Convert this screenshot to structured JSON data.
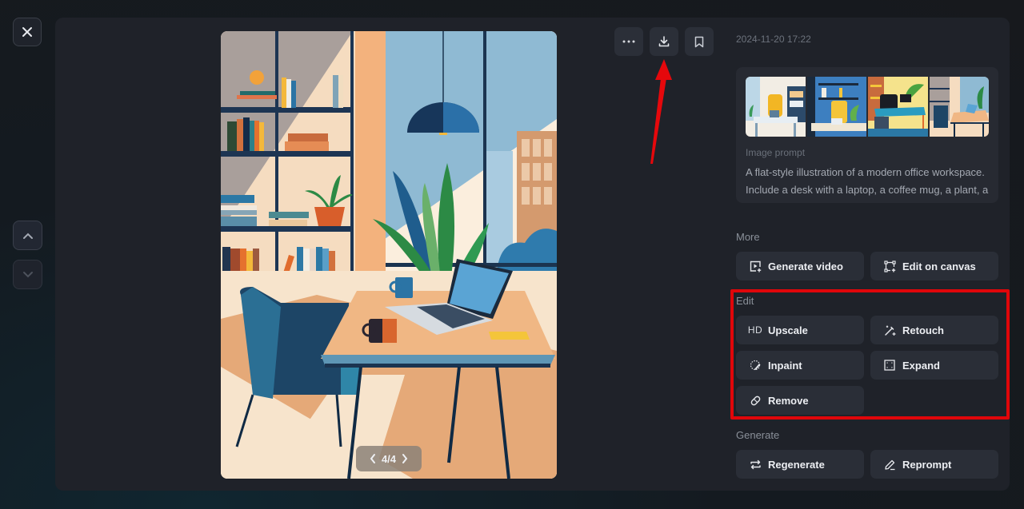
{
  "nav": {
    "close_icon": "close-icon",
    "prev_icon": "chevron-up-icon",
    "next_icon": "chevron-down-icon"
  },
  "viewer": {
    "image_description": "Flat-style illustration of a modern office workspace with bookshelves, pendant lamp, plant, desk with laptop and coffee mugs, and a blue armchair",
    "pager": {
      "current": "4/4",
      "prev_icon": "chevron-left-icon",
      "next_icon": "chevron-right-icon"
    },
    "toolbar": [
      {
        "id": "more",
        "icon": "more-horizontal-icon",
        "label": "More options"
      },
      {
        "id": "download",
        "icon": "download-icon",
        "label": "Download"
      },
      {
        "id": "bookmark",
        "icon": "bookmark-icon",
        "label": "Bookmark"
      }
    ]
  },
  "details": {
    "timestamp": "2024-11-20 17:22",
    "thumbnails_count": 4,
    "prompt_label": "Image prompt",
    "prompt_text": "A flat-style illustration of a modern office workspace. Include a desk with a laptop, a coffee mug, a plant, and a bookshelf in the background. Add large windows with natural light."
  },
  "sections": {
    "more": {
      "label": "More",
      "buttons": [
        {
          "label": "Generate video",
          "icon": "video-add-icon"
        },
        {
          "label": "Edit on canvas",
          "icon": "canvas-edit-icon"
        }
      ]
    },
    "edit": {
      "label": "Edit",
      "buttons": [
        {
          "label": "Upscale",
          "icon": "hd-icon",
          "icon_text": "HD"
        },
        {
          "label": "Retouch",
          "icon": "magic-wand-icon"
        },
        {
          "label": "Inpaint",
          "icon": "inpaint-brush-icon"
        },
        {
          "label": "Expand",
          "icon": "expand-frame-icon"
        },
        {
          "label": "Remove",
          "icon": "eraser-icon"
        }
      ]
    },
    "generate": {
      "label": "Generate",
      "buttons": [
        {
          "label": "Regenerate",
          "icon": "repeat-icon"
        },
        {
          "label": "Reprompt",
          "icon": "pencil-icon"
        }
      ]
    }
  },
  "annotations": {
    "highlight_color": "#e0060a",
    "highlight_target": "edit-section",
    "arrow_target": "download-button"
  }
}
